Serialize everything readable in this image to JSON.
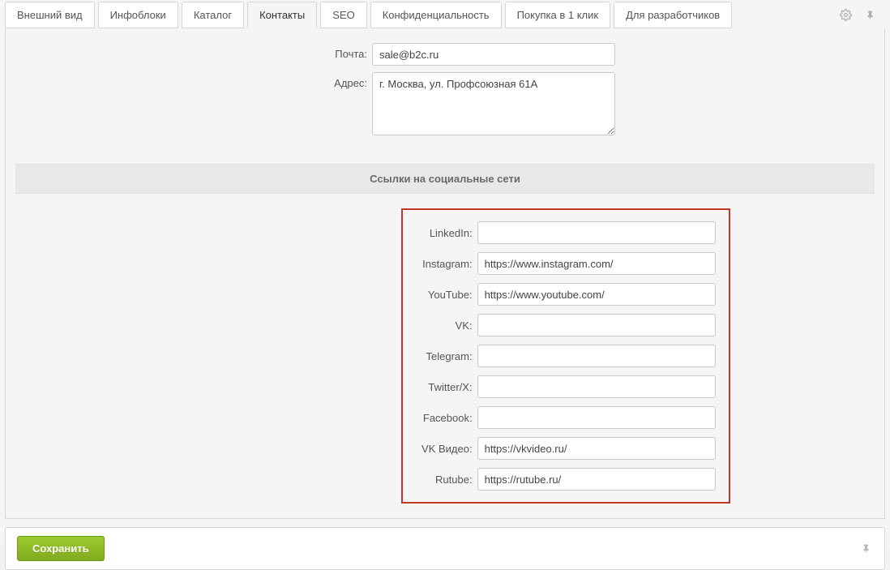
{
  "tabs": [
    {
      "label": "Внешний вид",
      "active": false
    },
    {
      "label": "Инфоблоки",
      "active": false
    },
    {
      "label": "Каталог",
      "active": false
    },
    {
      "label": "Контакты",
      "active": true
    },
    {
      "label": "SEO",
      "active": false
    },
    {
      "label": "Конфиденциальность",
      "active": false
    },
    {
      "label": "Покупка в 1 клик",
      "active": false
    },
    {
      "label": "Для разработчиков",
      "active": false
    }
  ],
  "contact": {
    "email_label": "Почта:",
    "email_value": "sale@b2c.ru",
    "address_label": "Адрес:",
    "address_value": "г. Москва, ул. Профсоюзная 61А"
  },
  "social_section_title": "Ссылки на социальные сети",
  "social": [
    {
      "key": "linkedin",
      "label": "LinkedIn:",
      "value": ""
    },
    {
      "key": "instagram",
      "label": "Instagram:",
      "value": "https://www.instagram.com/"
    },
    {
      "key": "youtube",
      "label": "YouTube:",
      "value": "https://www.youtube.com/"
    },
    {
      "key": "vk",
      "label": "VK:",
      "value": ""
    },
    {
      "key": "telegram",
      "label": "Telegram:",
      "value": ""
    },
    {
      "key": "twitterx",
      "label": "Twitter/X:",
      "value": ""
    },
    {
      "key": "facebook",
      "label": "Facebook:",
      "value": ""
    },
    {
      "key": "vkvideo",
      "label": "VK Видео:",
      "value": "https://vkvideo.ru/"
    },
    {
      "key": "rutube",
      "label": "Rutube:",
      "value": "https://rutube.ru/"
    }
  ],
  "footer": {
    "save_label": "Сохранить"
  }
}
